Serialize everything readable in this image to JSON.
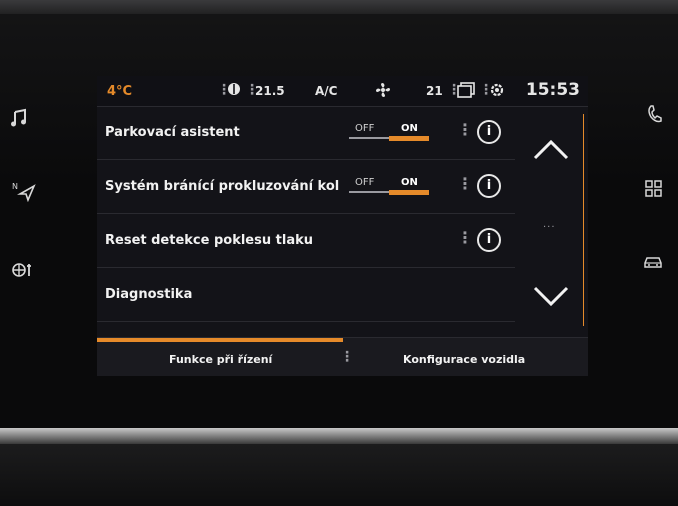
{
  "status_bar": {
    "temperature": "4°C",
    "temp_setting": "21.5",
    "ac_label": "A/C",
    "fan_level": "21",
    "clock": "15:53"
  },
  "settings": [
    {
      "label": "Parkovací asistent",
      "toggle": {
        "off_label": "OFF",
        "on_label": "ON",
        "state": "on"
      },
      "has_info": true
    },
    {
      "label": "Systém bránící prokluzování kol",
      "toggle": {
        "off_label": "OFF",
        "on_label": "ON",
        "state": "on"
      },
      "has_info": true
    },
    {
      "label": "Reset detekce poklesu tlaku",
      "has_info": true
    },
    {
      "label": "Diagnostika"
    }
  ],
  "tabs": [
    {
      "label": "Funkce při řízení",
      "active": true
    },
    {
      "label": "Konfigurace vozidla",
      "active": false
    }
  ],
  "side_buttons_left": [
    "music-note-icon",
    "navigation-icon",
    "climate-fan-icon"
  ],
  "side_buttons_right": [
    "phone-icon",
    "apps-grid-icon",
    "car-icon"
  ],
  "colors": {
    "accent": "#e58a2a",
    "background": "#131318",
    "text": "#f2f2f2"
  }
}
